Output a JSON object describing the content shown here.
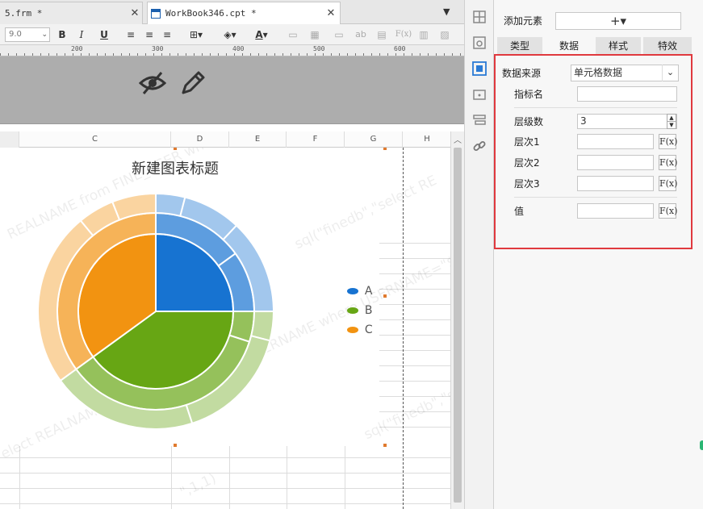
{
  "tabs": [
    {
      "label": "5.frm *",
      "active": false
    },
    {
      "label": "WorkBook346.cpt *",
      "active": true
    }
  ],
  "toolbar": {
    "font_size": "9.0",
    "bold": "B",
    "italic": "I",
    "underline": "U",
    "text_color": "A",
    "text_icon": "ab",
    "formula_icon": "F(x)"
  },
  "ruler": {
    "labels": [
      "200",
      "300",
      "400",
      "500",
      "600"
    ]
  },
  "columns": [
    "C",
    "D",
    "E",
    "F",
    "G",
    "H"
  ],
  "chart_data": {
    "type": "sunburst",
    "title": "新建图表标题",
    "legend": {
      "position": "right",
      "items": [
        "A",
        "B",
        "C"
      ]
    },
    "colors": {
      "A": "#1773d1",
      "B": "#67a614",
      "C": "#f29311"
    },
    "series": [
      {
        "name": "A",
        "inner": 25,
        "middle": [
          15,
          10
        ],
        "outer": [
          4,
          8,
          13
        ]
      },
      {
        "name": "B",
        "inner": 40,
        "middle": [
          5,
          35
        ],
        "outer": [
          4,
          16,
          20
        ]
      },
      {
        "name": "C",
        "inner": 35,
        "middle": [
          35
        ],
        "outer": [
          24,
          5,
          6
        ]
      }
    ]
  },
  "watermarks": [
    "REALNAME from FINE_USER where U",
    "sql(\"finedb\",\"select RE",
    "USERNAME where USERNAME=\"$fin",
    "sql(\"finedb\",\"select RE",
    "elect REALNAME from FINE_USER",
    "\",1,1)"
  ],
  "panel": {
    "add_element_label": "添加元素",
    "add_button": "+▾",
    "tabs": [
      "类型",
      "数据",
      "样式",
      "特效"
    ],
    "active_tab": "数据",
    "data_source_label": "数据来源",
    "data_source_value": "单元格数据",
    "indicator_label": "指标名",
    "indicator_value": "",
    "levels_label": "层级数",
    "levels_value": "3",
    "level_fields": [
      {
        "label": "层次1",
        "value": ""
      },
      {
        "label": "层次2",
        "value": ""
      },
      {
        "label": "层次3",
        "value": ""
      }
    ],
    "value_label": "值",
    "value_value": "",
    "fx_label": "F(x)"
  },
  "highlight_color": "#e0393e"
}
